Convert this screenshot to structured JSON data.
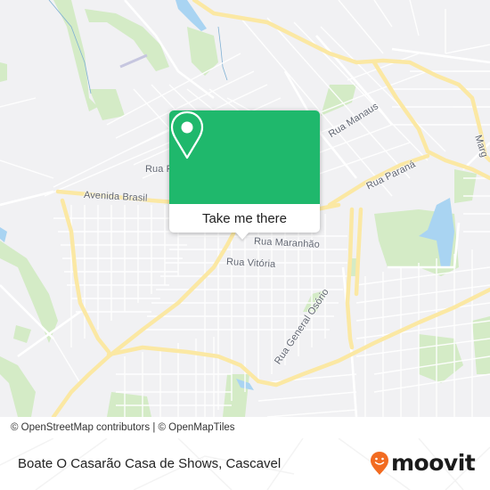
{
  "map": {
    "colors": {
      "background": "#f1f1f3",
      "street": "#ffffff",
      "major_road": "#fbe8a3",
      "park": "#d4ebc6",
      "water": "#a9d4f2"
    },
    "street_labels": [
      {
        "name": "street-label-rua-manaus",
        "text": "Rua Manaus"
      },
      {
        "name": "street-label-rua-parana",
        "text": "Rua Paraná"
      },
      {
        "name": "street-label-marginal",
        "text": "Marg"
      },
      {
        "name": "street-label-rua-r",
        "text": "Rua R"
      },
      {
        "name": "street-label-avenida-brasil",
        "text": "Avenida Brasil"
      },
      {
        "name": "street-label-rua-maranhao",
        "text": "Rua Maranhão"
      },
      {
        "name": "street-label-rua-vitoria",
        "text": "Rua Vitória"
      },
      {
        "name": "street-label-rua-general-osorio",
        "text": "Rua General Osório"
      }
    ]
  },
  "popup": {
    "icon": "map-pin-icon",
    "button_label": "Take me there",
    "accent_color": "#1fb86c"
  },
  "attribution": {
    "text": "© OpenStreetMap contributors | © OpenMapTiles"
  },
  "footer": {
    "place_title": "Boate O Casarão Casa de Shows, Cascavel",
    "brand": {
      "name": "moovit",
      "icon": "moovit-pin-logo-icon",
      "color": "#f26b21"
    }
  }
}
